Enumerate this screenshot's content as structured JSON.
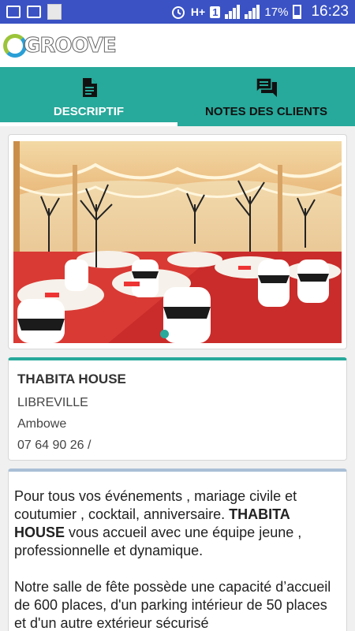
{
  "status_bar": {
    "network_type": "H+",
    "sim_badge": "1",
    "battery_percent": "17%",
    "time": "16:23",
    "icons": [
      "image-icon",
      "mail-icon",
      "notification-thumbnail",
      "alarm-icon",
      "signal-icon",
      "battery-icon"
    ]
  },
  "app": {
    "logo_text": "GROOVE"
  },
  "tabs": [
    {
      "label": "DESCRIPTIF",
      "icon": "document-icon",
      "active": true
    },
    {
      "label": "NOTES DES CLIENTS",
      "icon": "comments-icon",
      "active": false
    }
  ],
  "gallery": {
    "image": "banquet-hall-photo",
    "slide_count": 3,
    "active_slide": 1
  },
  "venue": {
    "name": "THABITA HOUSE",
    "city": "LIBREVILLE",
    "district": "Ambowe",
    "phone": "07 64 90 26 /"
  },
  "description": {
    "p1_part1": "Pour tous vos événements , mariage civile et coutumier , cocktail, anniversaire.",
    "p1_bold": "THABITA HOUSE",
    "p1_part2": "vous accueil avec une équipe jeune , professionnelle et dynamique.",
    "p2": "Notre salle de fête possède  une capacité d’accueil de 600 places, d'un parking intérieur de 50 places et d'un autre extérieur sécurisé"
  },
  "colors": {
    "status_bar": "#3b52c4",
    "teal_accent": "#27a99b",
    "desc_border": "#a9bfd6"
  }
}
